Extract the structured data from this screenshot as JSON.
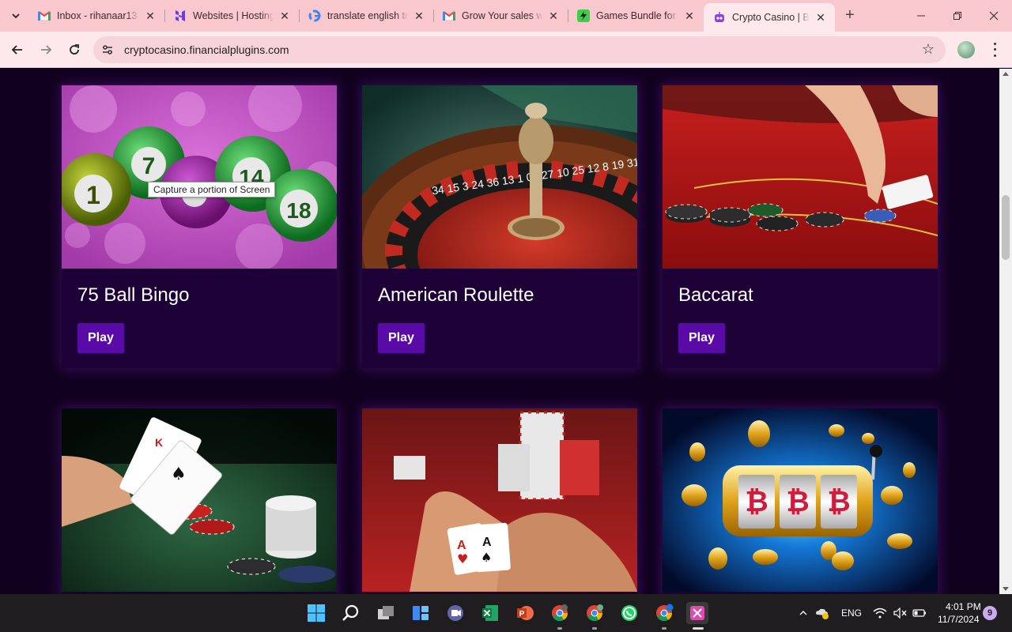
{
  "browser": {
    "tabs": [
      {
        "title": "Inbox - rihanaar13",
        "icon": "gmail-icon"
      },
      {
        "title": "Websites | Hosting",
        "icon": "hostinger-icon"
      },
      {
        "title": "translate english to",
        "icon": "google-icon"
      },
      {
        "title": "Grow Your sales w",
        "icon": "gmail-icon"
      },
      {
        "title": "Games Bundle for",
        "icon": "lightning-icon"
      },
      {
        "title": "Crypto Casino | Be",
        "icon": "robot-icon",
        "active": true
      }
    ],
    "url": "cryptocasino.financialplugins.com",
    "tab_close_glyph": "✕",
    "new_tab_glyph": "+"
  },
  "games": [
    {
      "title": "75 Ball Bingo",
      "button": "Play",
      "image": "bingo-balls"
    },
    {
      "title": "American Roulette",
      "button": "Play",
      "image": "roulette-wheel"
    },
    {
      "title": "Baccarat",
      "button": "Play",
      "image": "baccarat-table"
    },
    {
      "title": "",
      "button": "",
      "image": "blackjack-cards"
    },
    {
      "title": "",
      "button": "",
      "image": "poker-aces"
    },
    {
      "title": "",
      "button": "",
      "image": "bitcoin-slot-machine"
    }
  ],
  "bingo_ball_numbers": [
    "1",
    "7",
    "14",
    "18"
  ],
  "roulette_numbers": "34 15 3 24 36 13 1 00 27 10 25 12 8 19 31",
  "tooltip": "Capture a portion of Screen",
  "taskbar": {
    "language": "ENG",
    "time": "4:01 PM",
    "date": "11/7/2024",
    "notification_count": "9"
  },
  "colors": {
    "page_bg": "#12001f",
    "card_bg": "#1c0036",
    "play_button": "#5a0aa6",
    "tabstrip": "#f9c8cf"
  }
}
